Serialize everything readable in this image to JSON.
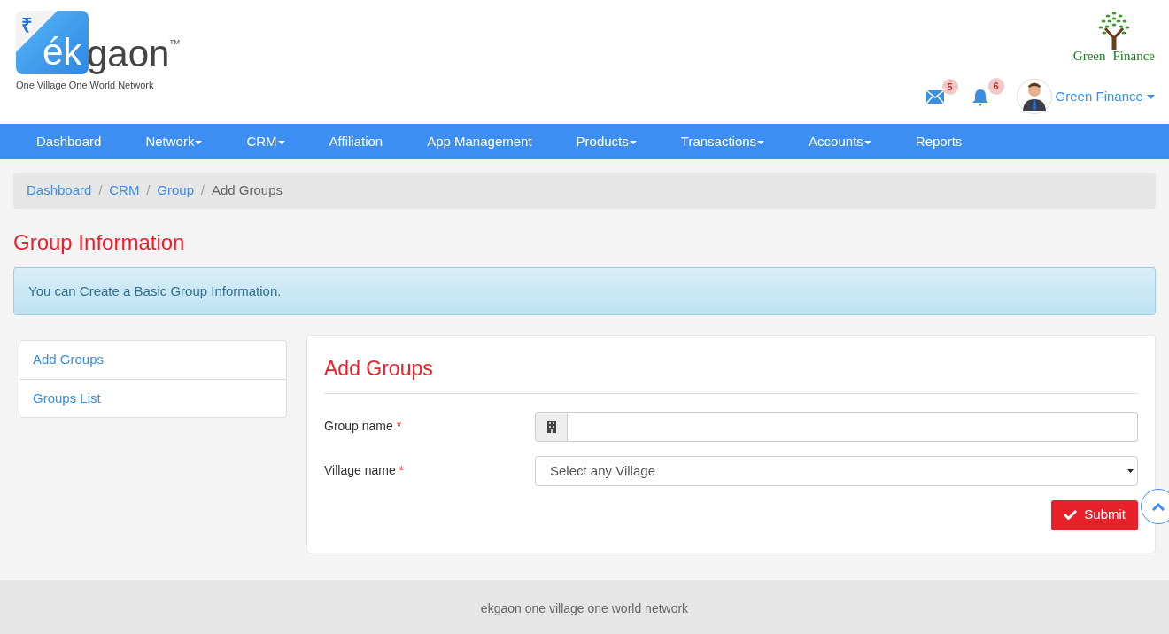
{
  "logo": {
    "symbol": "₹",
    "mark": "ék",
    "word": "gaon",
    "tm": "TM",
    "tagline": "One Village One World Network"
  },
  "partner_logo": {
    "left": "Green",
    "right": "Finance"
  },
  "header": {
    "messages_count": "5",
    "notifications_count": "6",
    "user_name": "Green Finance"
  },
  "nav": [
    {
      "label": "Dashboard",
      "has_menu": false
    },
    {
      "label": "Network",
      "has_menu": true
    },
    {
      "label": "CRM",
      "has_menu": true
    },
    {
      "label": "Affiliation",
      "has_menu": false
    },
    {
      "label": "App Management",
      "has_menu": false
    },
    {
      "label": "Products",
      "has_menu": true
    },
    {
      "label": "Transactions",
      "has_menu": true
    },
    {
      "label": "Accounts",
      "has_menu": true
    },
    {
      "label": "Reports",
      "has_menu": false
    }
  ],
  "breadcrumb_separator": "/",
  "breadcrumb": [
    {
      "label": "Dashboard",
      "current": false
    },
    {
      "label": "CRM",
      "current": false
    },
    {
      "label": "Group",
      "current": false
    },
    {
      "label": "Add Groups",
      "current": true
    }
  ],
  "page_title": "Group Information",
  "alert": "You can Create a Basic Group Information.",
  "sidebar": {
    "items": [
      {
        "label": "Add Groups"
      },
      {
        "label": "Groups List"
      }
    ]
  },
  "form": {
    "title": "Add Groups",
    "required_mark": "*",
    "fields": [
      {
        "kind": "text",
        "label": "Group name",
        "required": true
      },
      {
        "kind": "select",
        "label": "Village name",
        "required": true,
        "value": "Select any Village"
      }
    ],
    "submit": "Submit"
  },
  "footer": "ekgaon one village one world network"
}
